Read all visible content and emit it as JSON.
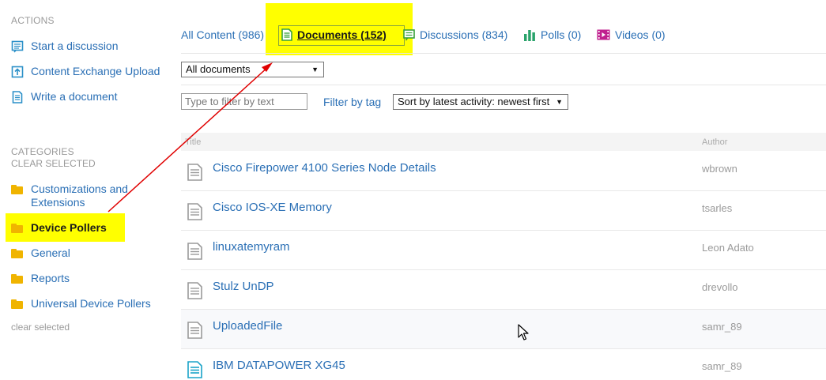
{
  "sidebar": {
    "actions_heading": "ACTIONS",
    "actions": [
      {
        "label": "Start a discussion",
        "icon": "discussion-icon"
      },
      {
        "label": "Content Exchange Upload",
        "icon": "upload-icon"
      },
      {
        "label": "Write a document",
        "icon": "document-icon"
      }
    ],
    "categories_heading": "CATEGORIES",
    "clear_selected_top": "CLEAR SELECTED",
    "categories": [
      {
        "label": "Customizations and Extensions",
        "line1": "Customizations and",
        "line2": "Extensions",
        "selected": false
      },
      {
        "label": "Device Pollers",
        "selected": true
      },
      {
        "label": "General",
        "selected": false
      },
      {
        "label": "Reports",
        "selected": false
      },
      {
        "label": "Universal Device Pollers",
        "selected": false
      }
    ],
    "clear_selected_bottom": "clear selected"
  },
  "tabs": [
    {
      "label": "All Content (986)",
      "icon": null,
      "active": false
    },
    {
      "label": "Documents (152)",
      "icon": "document-icon",
      "active": true
    },
    {
      "label": "Discussions (834)",
      "icon": "discussion-icon",
      "active": false
    },
    {
      "label": "Polls (0)",
      "icon": "poll-icon",
      "active": false
    },
    {
      "label": "Videos (0)",
      "icon": "video-icon",
      "active": false
    }
  ],
  "filters": {
    "doc_type_selected": "All documents",
    "text_filter_placeholder": "Type to filter by text",
    "filter_by_tag": "Filter by tag",
    "sort_selected": "Sort by latest activity: newest first"
  },
  "table": {
    "columns": [
      "Title",
      "Author"
    ],
    "rows": [
      {
        "title": "Cisco Firepower 4100 Series Node Details",
        "author": "wbrown",
        "icon": "document-icon"
      },
      {
        "title": "Cisco IOS-XE Memory",
        "author": "tsarles",
        "icon": "document-icon"
      },
      {
        "title": "linuxatemyram",
        "author": "Leon Adato",
        "icon": "document-icon"
      },
      {
        "title": "Stulz UnDP",
        "author": "drevollo",
        "icon": "document-icon"
      },
      {
        "title": "UploadedFile",
        "author": "samr_89",
        "icon": "document-icon"
      },
      {
        "title": "IBM DATAPOWER XG45",
        "author": "samr_89",
        "icon": "document-icon-teal"
      }
    ]
  },
  "colors": {
    "link": "#2a6fb5",
    "highlight": "#ffff00",
    "folder": "#f0b400",
    "annotation_arrow": "#e00000",
    "discussion_icon": "#3aa03a",
    "video_icon": "#c0208f"
  }
}
